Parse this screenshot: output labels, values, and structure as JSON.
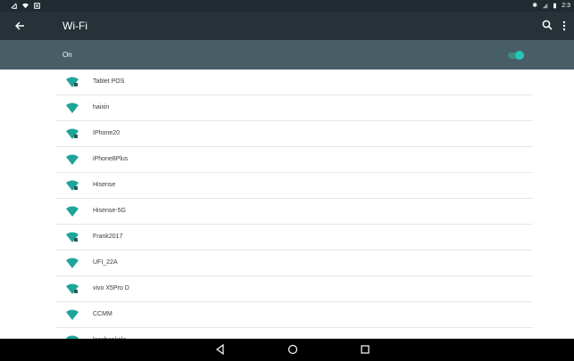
{
  "status_bar": {
    "left_icons": [
      "download-icon",
      "wifi-icon",
      "notification-icon"
    ],
    "right_icons": [
      "bluetooth-icon",
      "signal-icon",
      "battery-icon"
    ],
    "time": "2:3"
  },
  "app_bar": {
    "title": "Wi-Fi",
    "back_icon": "arrow-left-icon",
    "search_icon": "search-icon",
    "more_icon": "more-vert-icon"
  },
  "wifi_switch": {
    "label": "On",
    "enabled": true,
    "accent_color": "#27c4b8"
  },
  "networks": [
    {
      "name": "Tablet POS"
    },
    {
      "name": "haixin"
    },
    {
      "name": "IPhone20"
    },
    {
      "name": "iPhone8Plus"
    },
    {
      "name": "Hisense"
    },
    {
      "name": "Hisense-5G"
    },
    {
      "name": "Frank2017"
    },
    {
      "name": "UFI_22A"
    },
    {
      "name": "vivo X5Pro D"
    },
    {
      "name": "CCMM"
    },
    {
      "name": "laoshankele"
    }
  ],
  "colors": {
    "status_bar": "#1f2b30",
    "app_bar": "#263238",
    "switch_bar": "#485e66",
    "wifi_icon": "#1fa59a",
    "nav_bar": "#000000"
  },
  "nav_bar": {
    "buttons": [
      "back-triangle-icon",
      "home-circle-icon",
      "recents-square-icon"
    ]
  }
}
